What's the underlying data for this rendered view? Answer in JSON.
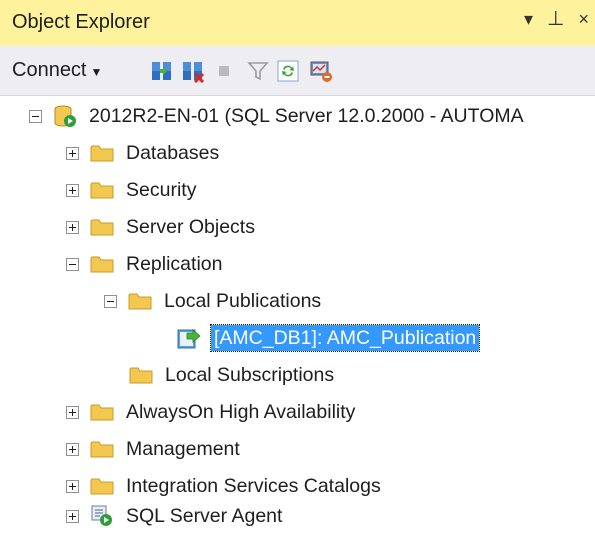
{
  "panel": {
    "title": "Object Explorer",
    "controls": {
      "dropdown": "▾",
      "pin": "⊥",
      "close": "×"
    }
  },
  "toolbar": {
    "connect_label": "Connect",
    "icons": [
      "connect-icon",
      "disconnect-icon",
      "stop-icon",
      "filter-icon",
      "refresh-icon",
      "activity-monitor-icon"
    ]
  },
  "tree": {
    "server": "2012R2-EN-01 (SQL Server 12.0.2000 - AUTOMA",
    "nodes": {
      "databases": "Databases",
      "security": "Security",
      "server_objects": "Server Objects",
      "replication": "Replication",
      "local_publications": "Local Publications",
      "publication": "[AMC_DB1]: AMC_Publication",
      "local_subscriptions": "Local Subscriptions",
      "alwayson": "AlwaysOn High Availability",
      "management": "Management",
      "integration_services": "Integration Services Catalogs",
      "sql_agent": "SQL Server Agent"
    }
  },
  "colors": {
    "title_bg": "#fff29d",
    "toolbar_bg": "#eeeef2",
    "selection_bg": "#3399ff",
    "folder": "#f3c850"
  }
}
